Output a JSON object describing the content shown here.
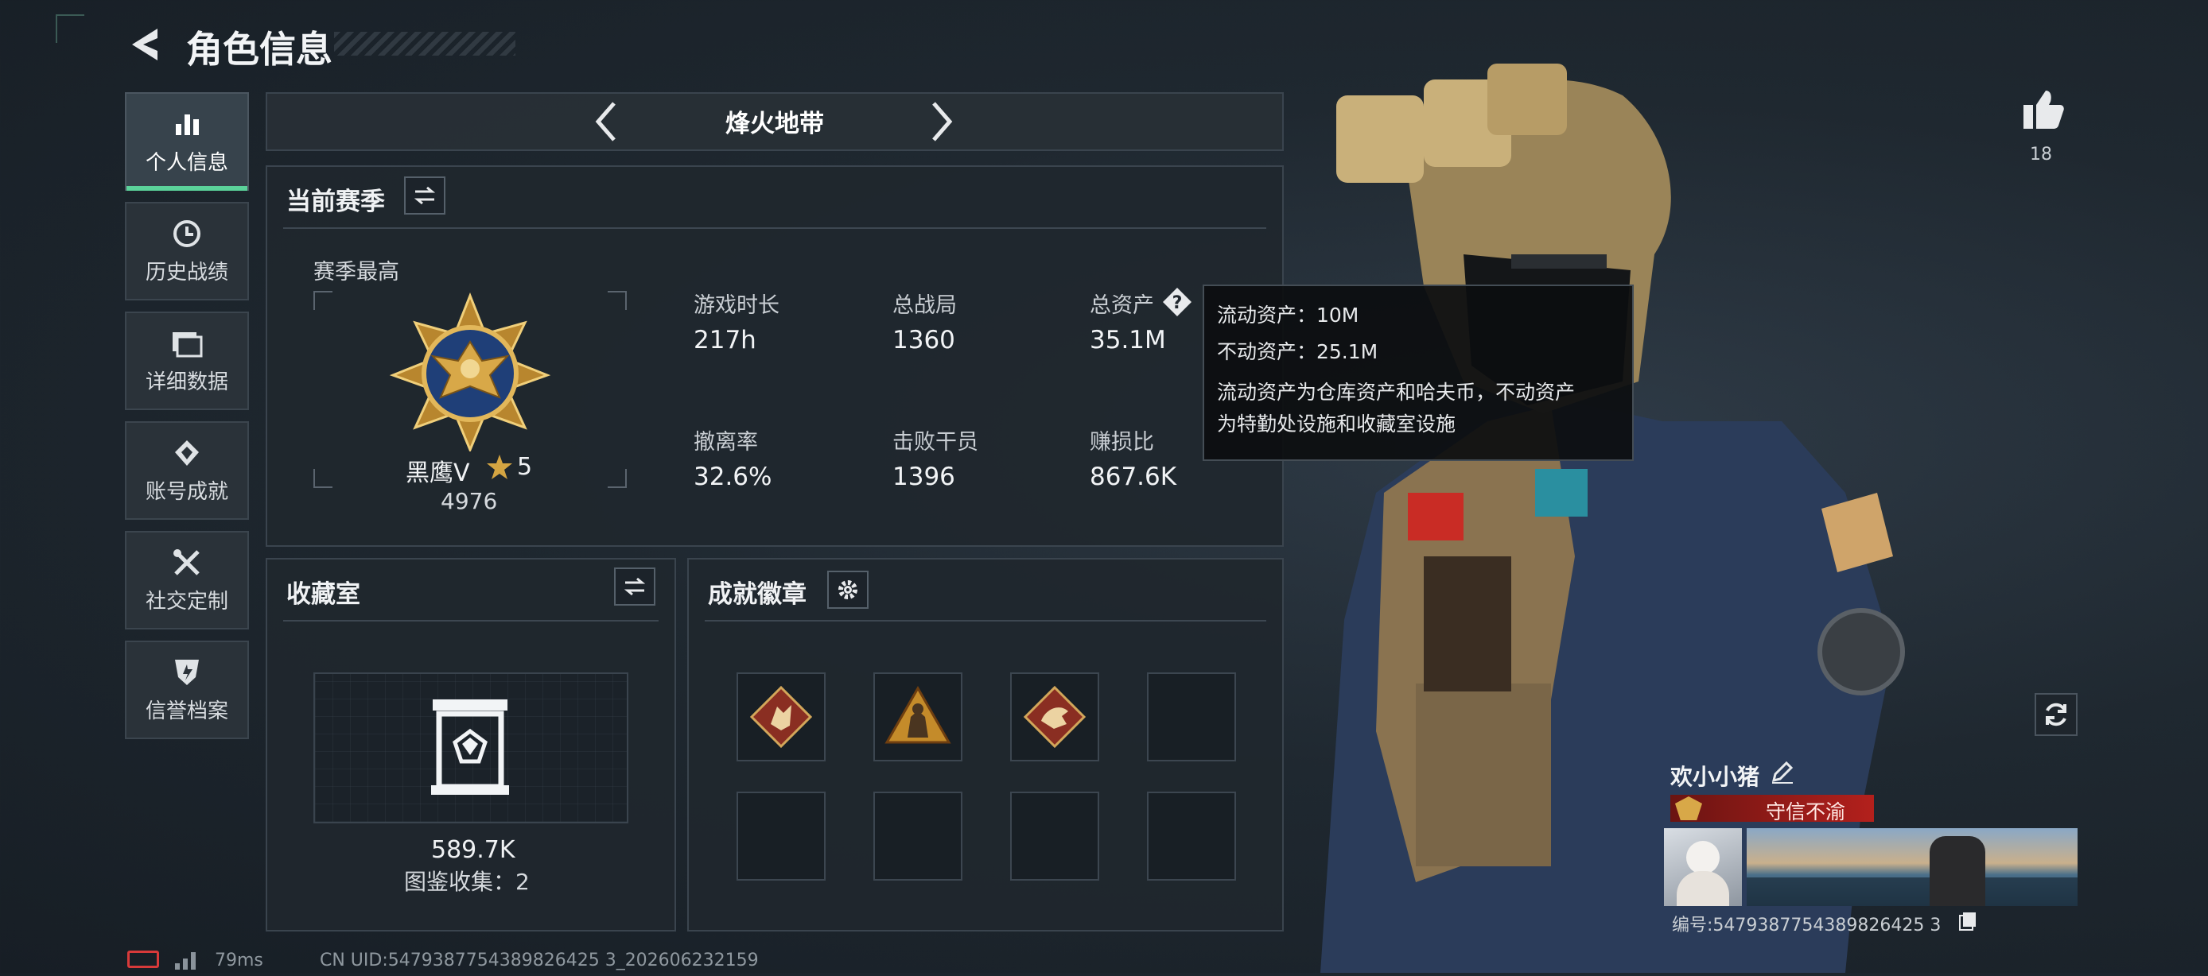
{
  "header": {
    "title": "角色信息"
  },
  "sidebar": {
    "items": [
      {
        "label": "个人信息",
        "icon": "bar-chart-icon",
        "active": true
      },
      {
        "label": "历史战绩",
        "icon": "clock-icon"
      },
      {
        "label": "详细数据",
        "icon": "folder-icon"
      },
      {
        "label": "账号成就",
        "icon": "achievement-icon"
      },
      {
        "label": "社交定制",
        "icon": "tools-icon"
      },
      {
        "label": "信誉档案",
        "icon": "shield-icon"
      }
    ]
  },
  "mode_selector": {
    "current": "烽火地带"
  },
  "season": {
    "title": "当前赛季",
    "best_label": "赛季最高",
    "rank_name": "黑鹰V",
    "rank_stars": "5",
    "rank_points": "4976",
    "stats": [
      {
        "label": "游戏时长",
        "value": "217h"
      },
      {
        "label": "总战局",
        "value": "1360"
      },
      {
        "label": "总资产",
        "value": "35.1M"
      },
      {
        "label": "撤离率",
        "value": "32.6%"
      },
      {
        "label": "击败干员",
        "value": "1396"
      },
      {
        "label": "赚损比",
        "value": "867.6K"
      }
    ]
  },
  "tooltip": {
    "liquid": "流动资产：10M",
    "fixed": "不动资产：25.1M",
    "desc1": "流动资产为仓库资产和哈夫币，不动资产",
    "desc2": "为特勤处设施和收藏室设施"
  },
  "collection": {
    "title": "收藏室",
    "value": "589.7K",
    "count_label": "图鉴收集：2"
  },
  "badges": {
    "title": "成就徽章"
  },
  "likes": {
    "count": "18"
  },
  "player": {
    "name": "欢小小猪",
    "honor_tag": "守信不渝",
    "id_label": "编号:5479387754389826425 3"
  },
  "footer": {
    "ping": "79ms",
    "uid": "CN UID:5479387754389826425 3_202606232159"
  },
  "colors": {
    "accent": "#5bd29a",
    "honor_bg": "#b3201c",
    "rank_gold": "#d4a542"
  }
}
